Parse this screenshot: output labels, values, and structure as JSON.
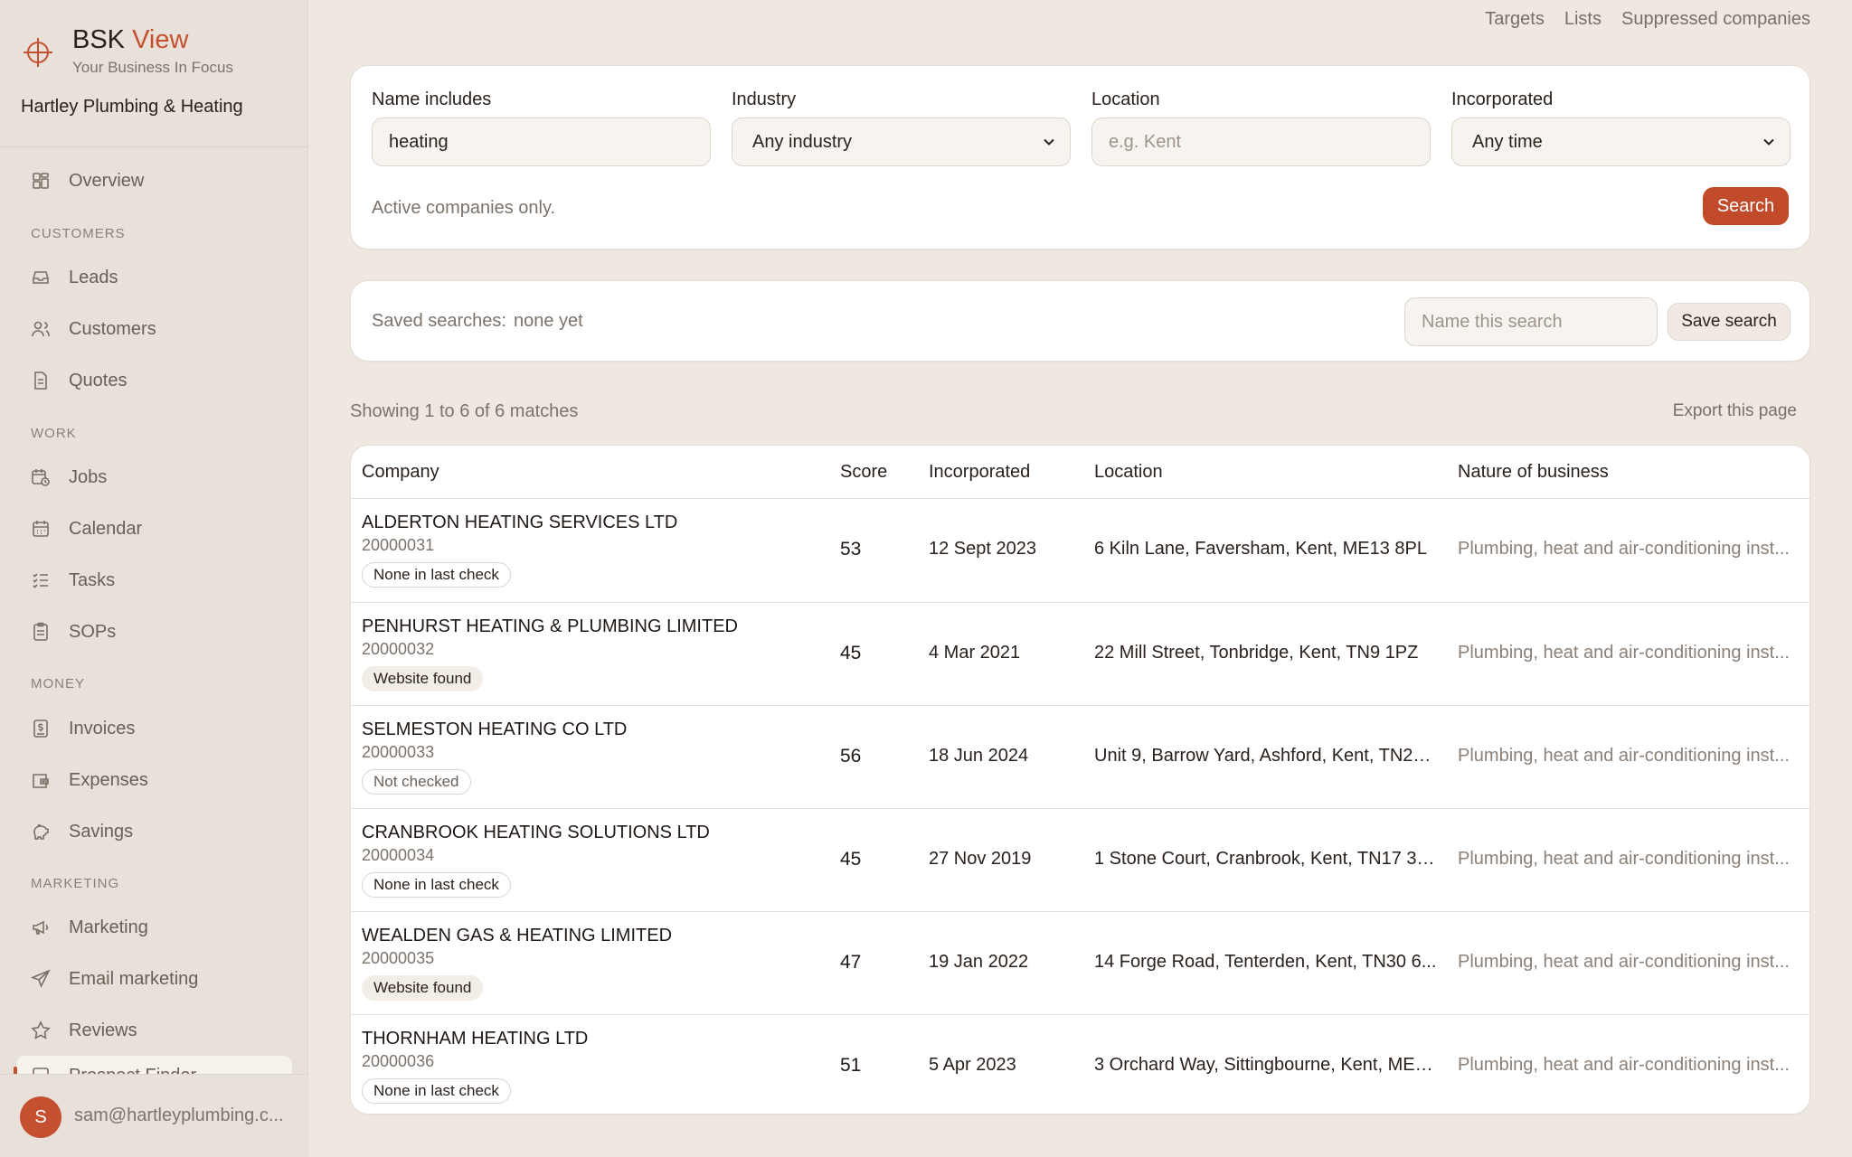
{
  "brand": {
    "name_main": "BSK",
    "name_accent": "View",
    "tagline": "Your Business In Focus",
    "accent_color": "#c4502f"
  },
  "business_name": "Hartley Plumbing & Heating",
  "sidebar": {
    "overview": "Overview",
    "sections": {
      "customers": "CUSTOMERS",
      "work": "WORK",
      "money": "MONEY",
      "marketing": "MARKETING"
    },
    "items": {
      "leads": "Leads",
      "customers": "Customers",
      "quotes": "Quotes",
      "jobs": "Jobs",
      "calendar": "Calendar",
      "tasks": "Tasks",
      "sops": "SOPs",
      "invoices": "Invoices",
      "expenses": "Expenses",
      "savings": "Savings",
      "marketing": "Marketing",
      "email_marketing": "Email marketing",
      "reviews": "Reviews",
      "prospect_finder": "Prospect Finder"
    }
  },
  "user": {
    "initial": "S",
    "email": "sam@hartleyplumbing.c..."
  },
  "toplinks": {
    "targets": "Targets",
    "lists": "Lists",
    "suppressed": "Suppressed companies"
  },
  "filters": {
    "name_label": "Name includes",
    "name_value": "heating",
    "industry_label": "Industry",
    "industry_value": "Any industry",
    "location_label": "Location",
    "location_placeholder": "e.g. Kent",
    "incorporated_label": "Incorporated",
    "incorporated_value": "Any time",
    "note": "Active companies only.",
    "search_button": "Search"
  },
  "saved": {
    "label": "Saved searches:",
    "value": "none yet",
    "name_placeholder": "Name this search",
    "save_button": "Save search"
  },
  "results": {
    "showing": "Showing 1 to 6 of 6 matches",
    "export": "Export this page"
  },
  "table": {
    "headers": {
      "company": "Company",
      "score": "Score",
      "incorporated": "Incorporated",
      "location": "Location",
      "nature": "Nature of business"
    },
    "rows": [
      {
        "name": "ALDERTON HEATING SERVICES LTD",
        "number": "20000031",
        "badge": "None in last check",
        "score": "53",
        "incorporated": "12 Sept 2023",
        "location": "6 Kiln Lane, Faversham, Kent, ME13 8PL",
        "nature": "Plumbing, heat and air-conditioning inst..."
      },
      {
        "name": "PENHURST HEATING & PLUMBING LIMITED",
        "number": "20000032",
        "badge": "Website found",
        "score": "45",
        "incorporated": "4 Mar 2021",
        "location": "22 Mill Street, Tonbridge, Kent, TN9 1PZ",
        "nature": "Plumbing, heat and air-conditioning inst..."
      },
      {
        "name": "SELMESTON HEATING CO LTD",
        "number": "20000033",
        "badge": "Not checked",
        "score": "56",
        "incorporated": "18 Jun 2024",
        "location": "Unit 9, Barrow Yard, Ashford, Kent, TN23 ...",
        "nature": "Plumbing, heat and air-conditioning inst..."
      },
      {
        "name": "CRANBROOK HEATING SOLUTIONS LTD",
        "number": "20000034",
        "badge": "None in last check",
        "score": "45",
        "incorporated": "27 Nov 2019",
        "location": "1 Stone Court, Cranbrook, Kent, TN17 3DN",
        "nature": "Plumbing, heat and air-conditioning inst..."
      },
      {
        "name": "WEALDEN GAS & HEATING LIMITED",
        "number": "20000035",
        "badge": "Website found",
        "score": "47",
        "incorporated": "19 Jan 2022",
        "location": "14 Forge Road, Tenterden, Kent, TN30 6...",
        "nature": "Plumbing, heat and air-conditioning inst..."
      },
      {
        "name": "THORNHAM HEATING LTD",
        "number": "20000036",
        "badge": "None in last check",
        "score": "51",
        "incorporated": "5 Apr 2023",
        "location": "3 Orchard Way, Sittingbourne, Kent, ME1...",
        "nature": "Plumbing, heat and air-conditioning inst..."
      }
    ]
  }
}
